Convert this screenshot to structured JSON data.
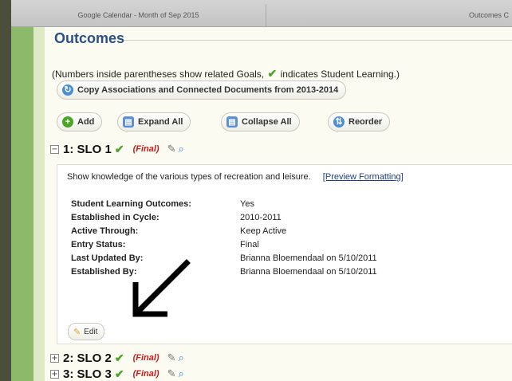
{
  "browser": {
    "tabs": [
      "Google Calendar - Month of Sep 2015",
      "Outcomes C"
    ]
  },
  "page": {
    "title": "Outcomes",
    "note_before": "(Numbers inside parentheses show related Goals,",
    "note_after": "indicates Student Learning.)",
    "copy_button": "Copy Associations and Connected Documents from 2013-2014"
  },
  "toolbar": {
    "add": "Add",
    "expand_all": "Expand All",
    "collapse_all": "Collapse All",
    "reorder": "Reorder"
  },
  "slos": [
    {
      "title": "1: SLO 1",
      "status": "(Final)",
      "expanded": true
    },
    {
      "title": "2: SLO 2",
      "status": "(Final)",
      "expanded": false
    },
    {
      "title": "3: SLO 3",
      "status": "(Final)",
      "expanded": false
    }
  ],
  "detail": {
    "description": "Show knowledge of the various types of recreation and leisure.",
    "preview_link": "[Preview Formatting]",
    "rows": [
      {
        "label": "Student Learning Outcomes:",
        "value": "Yes"
      },
      {
        "label": "Established in Cycle:",
        "value": "2010-2011"
      },
      {
        "label": "Active Through:",
        "value": "Keep Active"
      },
      {
        "label": "Entry Status:",
        "value": "Final"
      },
      {
        "label": "Last Updated By:",
        "value": "Brianna Bloemendaal on 5/10/2011"
      },
      {
        "label": "Established By:",
        "value": "Brianna Bloemendaal on 5/10/2011"
      }
    ],
    "edit_button": "Edit"
  },
  "colors": {
    "title": "#2d4f87",
    "final": "#c81d1d",
    "check": "#4aa526",
    "sidebar_green": "#8cb96a"
  },
  "icons": {
    "check": "check-icon",
    "refresh": "refresh-icon",
    "add": "plus-circle-icon",
    "expand": "expand-icon",
    "collapse": "collapse-icon",
    "reorder": "reorder-icon",
    "edit": "pencil-icon",
    "search": "magnifier-icon",
    "pointer": "arrow-pointer-icon"
  }
}
